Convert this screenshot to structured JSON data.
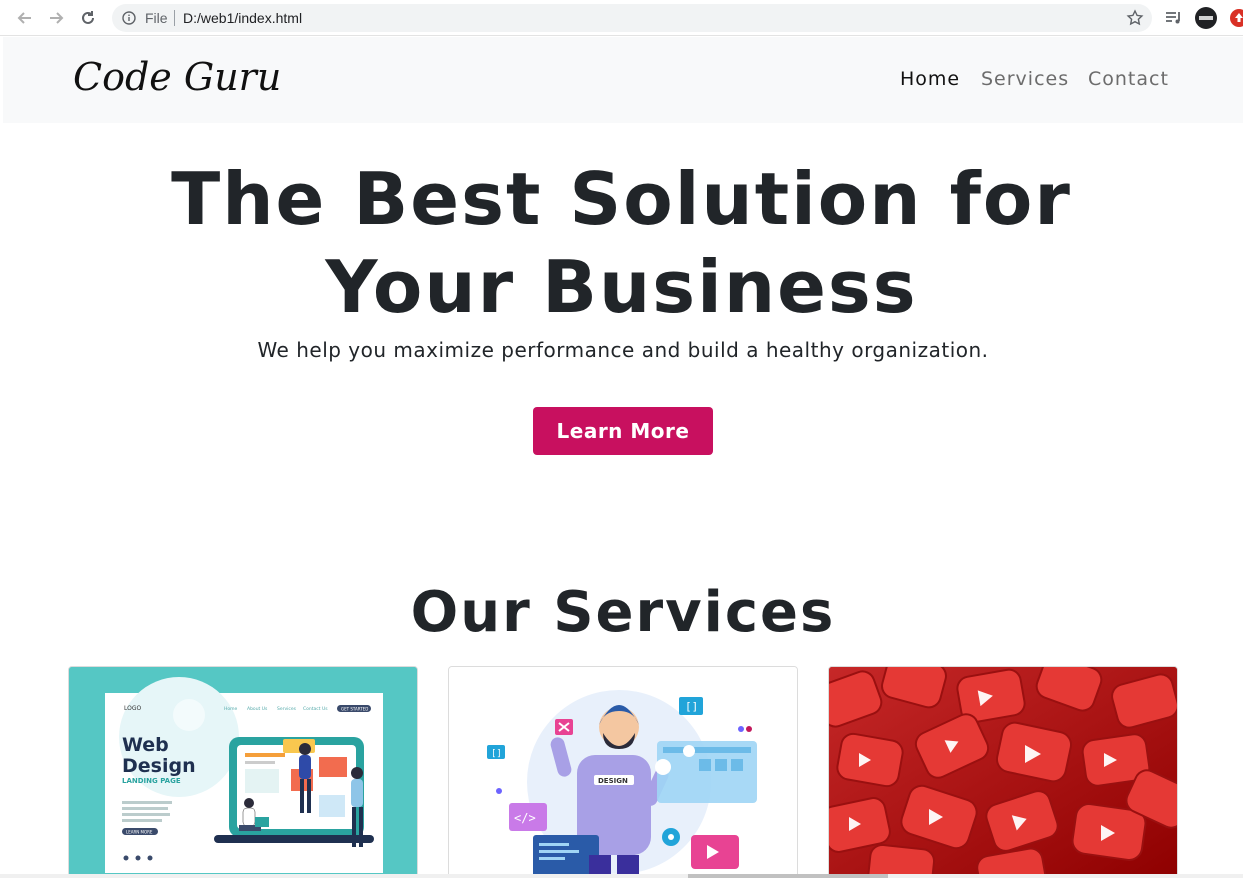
{
  "browser": {
    "file_label": "File",
    "url": "D:/web1/index.html"
  },
  "navbar": {
    "brand": "Code Guru",
    "links": [
      {
        "label": "Home"
      },
      {
        "label": "Services"
      },
      {
        "label": "Contact"
      }
    ]
  },
  "hero": {
    "title_line1": "The Best Solution for",
    "title_line2": "Your Business",
    "subtitle": "We help you maximize performance and build a healthy organization.",
    "button_label": "Learn More"
  },
  "services": {
    "title": "Our Services",
    "card1": {
      "nav_logo": "LOGO",
      "nav_items": [
        "Home",
        "About Us",
        "Services",
        "Contact Us"
      ],
      "nav_button": "GET STARTED",
      "heading_line1": "Web",
      "heading_line2": "Design",
      "tag": "LANDING PAGE",
      "cta": "LEARN MORE"
    },
    "card2": {
      "shirt_text": "DESIGN"
    }
  },
  "colors": {
    "accent": "#c8105f",
    "navbar_bg": "#f8f9fa",
    "text_dark": "#212529",
    "card1_bg": "#55c7c4"
  }
}
